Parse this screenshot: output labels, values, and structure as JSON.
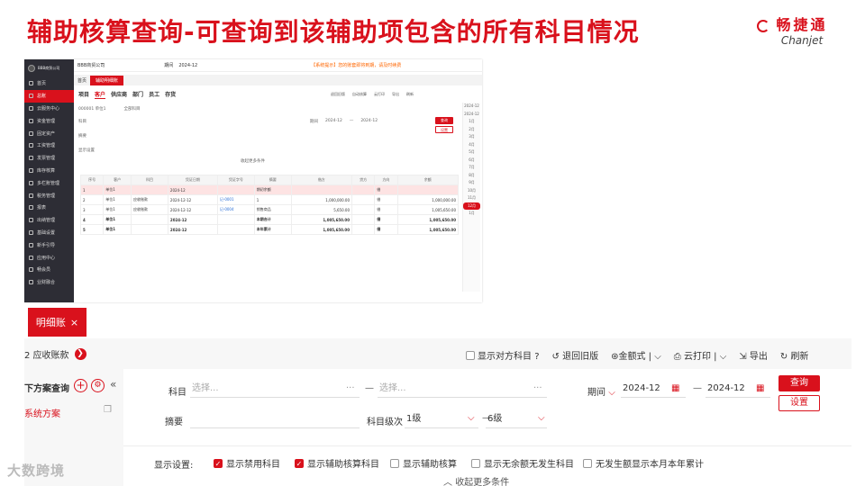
{
  "slide": {
    "title": "辅助核算查询-可查询到该辅助项包含的所有科目情况",
    "brand_cn": "畅捷通",
    "brand_en": "Chanjet",
    "watermark": "大数跨境"
  },
  "small_app": {
    "company": "BBB商贸公司",
    "period_label": "期间",
    "period_value": "2024-12",
    "warning": "【系统提示】您的账套即将到期，请及时续费",
    "sidebar": [
      "首页",
      "总账",
      "云服务中心",
      "资金管理",
      "固定资产",
      "工资管理",
      "发票管理",
      "库存核算",
      "多栏账管理",
      "税务管理",
      "报表",
      "出纳管理",
      "基础设置",
      "新手引导",
      "应用中心",
      "畅会员",
      "业财融合"
    ],
    "tabs": [
      "首页",
      "辅助明细账"
    ],
    "subtabs": [
      "项目",
      "客户",
      "供应商",
      "部门",
      "员工",
      "存货"
    ],
    "toolbar": [
      "退回旧版",
      "自动核算",
      "云打印",
      "导出",
      "刷新"
    ],
    "filter_item": "000001 单位1",
    "filter_all": "全部科目",
    "filter_subject": "科目",
    "filter_summary": "摘要",
    "filter_display": "显示设置",
    "filter_period": "期间",
    "from": "2024-12",
    "to": "2024-12",
    "query": "查询",
    "settings": "设置",
    "collapse": "收起更多条件",
    "table": {
      "headers": [
        "序号",
        "客户",
        "科目",
        "凭证日期",
        "凭证字号",
        "摘要",
        "借方",
        "贷方",
        "方向",
        "余额"
      ],
      "rows": [
        [
          "1",
          "单位1",
          "",
          "2024-12",
          "",
          "期初余额",
          "",
          "",
          "借",
          ""
        ],
        [
          "2",
          "单位1",
          "应收账款",
          "2024-12-12",
          "记-0001",
          "1",
          "1,000,000.00",
          "",
          "借",
          "1,000,000.00"
        ],
        [
          "3",
          "单位1",
          "应收账款",
          "2024-12-12",
          "记-0004",
          "销售商品",
          "5,650.00",
          "",
          "借",
          "1,005,650.00"
        ],
        [
          "4",
          "单位1",
          "",
          "2024-12",
          "",
          "本期合计",
          "1,005,650.00",
          "",
          "借",
          "1,005,650.00"
        ],
        [
          "5",
          "单位1",
          "",
          "2024-12",
          "",
          "本年累计",
          "1,005,650.00",
          "",
          "借",
          "1,005,650.00"
        ]
      ]
    },
    "months": [
      "2024-12",
      "2024-12",
      "1月",
      "2月",
      "3月",
      "4月",
      "5月",
      "6月",
      "7月",
      "8月",
      "9月",
      "10月",
      "11月",
      "12月",
      "1月"
    ]
  },
  "zoom": {
    "tab_label": "明细账",
    "subject_crumb": "2 应收账款",
    "show_opposite": "显示对方科目",
    "back_old": "退回旧版",
    "amount_type": "金额式",
    "cloud_print": "云打印",
    "export": "导出",
    "refresh": "刷新",
    "scheme_title": "下方案查询",
    "system_scheme": "系统方案",
    "subject_label": "科目",
    "subject_from_placeholder": "选择...",
    "subject_to_placeholder": "选择...",
    "period_label": "期间",
    "from": "2024-12",
    "to": "2024-12",
    "query": "查询",
    "settings": "设置",
    "summary_label": "摘要",
    "level_label": "科目级次",
    "level_from": "1级",
    "level_to": "6级",
    "display_label": "显示设置:",
    "options": [
      {
        "label": "显示禁用科目",
        "checked": true
      },
      {
        "label": "显示辅助核算科目",
        "checked": true
      },
      {
        "label": "显示辅助核算",
        "checked": false
      },
      {
        "label": "显示无余额无发生科目",
        "checked": false
      },
      {
        "label": "无发生额显示本月本年累计",
        "checked": false
      }
    ],
    "collapse": "收起更多条件"
  },
  "colors": {
    "accent": "#d9111c"
  }
}
